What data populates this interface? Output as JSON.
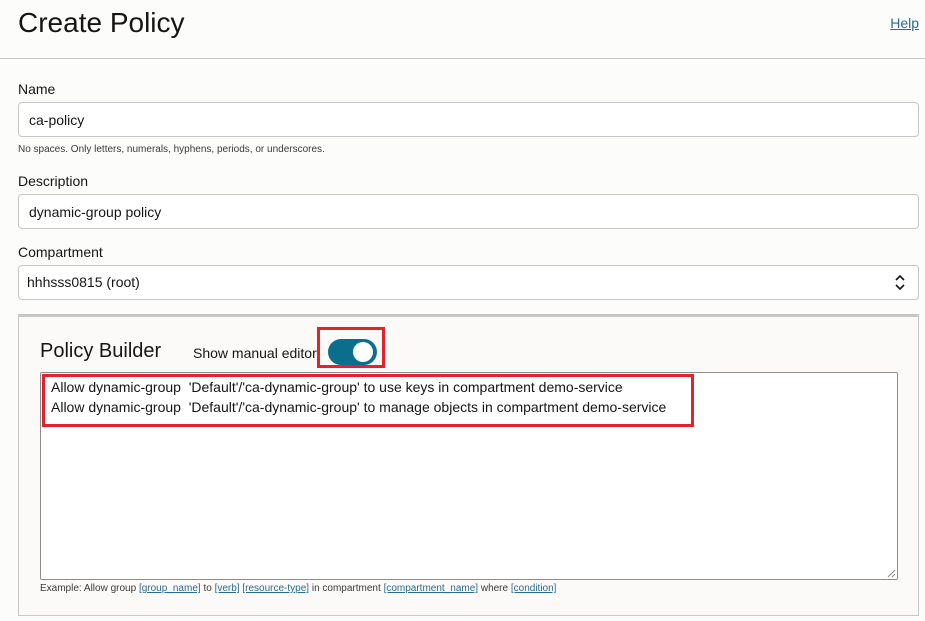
{
  "header": {
    "title": "Create Policy",
    "help_link": "Help"
  },
  "form": {
    "name": {
      "label": "Name",
      "value": "ca-policy",
      "hint": "No spaces. Only letters, numerals, hyphens, periods, or underscores."
    },
    "description": {
      "label": "Description",
      "value": "dynamic-group policy"
    },
    "compartment": {
      "label": "Compartment",
      "selected": "hhhsss0815 (root)"
    }
  },
  "policy_builder": {
    "title": "Policy Builder",
    "toggle_label": "Show manual editor",
    "toggle_on": true,
    "statements": [
      "Allow dynamic-group  'Default'/'ca-dynamic-group' to use keys in compartment demo-service",
      "Allow dynamic-group  'Default'/'ca-dynamic-group' to manage objects in compartment demo-service"
    ],
    "example": {
      "prefix": "Example: Allow group ",
      "group_name": "[group_name]",
      "to": " to ",
      "verb": "[verb]",
      "resource_type": "[resource-type]",
      "in_compartment": " in compartment ",
      "compartment_name": "[compartment_name]",
      "where": " where ",
      "condition": "[condition]"
    }
  },
  "colors": {
    "accent": "#0c6e8f",
    "highlight": "#e4222b",
    "link": "#2c6a8f"
  }
}
